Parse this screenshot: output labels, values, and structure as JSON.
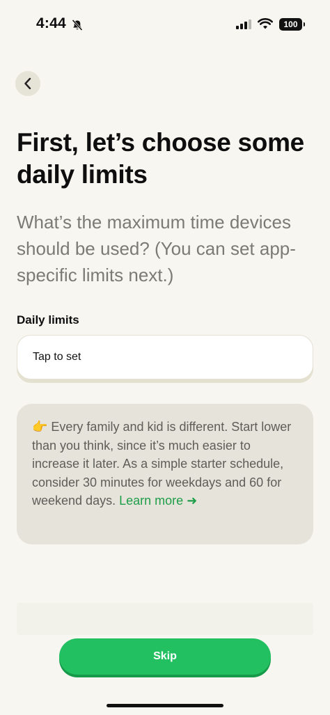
{
  "status_bar": {
    "time": "4:44",
    "battery": "100"
  },
  "title": "First, let’s choose some daily limits",
  "subtitle": "What’s the maximum time devices should be used? (You can set app-specific limits next.)",
  "daily_limits": {
    "label": "Daily limits",
    "value": "Tap to set"
  },
  "tip": {
    "emoji": "👉",
    "text": " Every family and kid is different. Start lower than you think, since it’s much easier to increase it later. As a simple starter schedule, consider 30 minutes for weekdays and 60 for weekend days. ",
    "link": "Learn more ➜"
  },
  "skip_label": "Skip"
}
